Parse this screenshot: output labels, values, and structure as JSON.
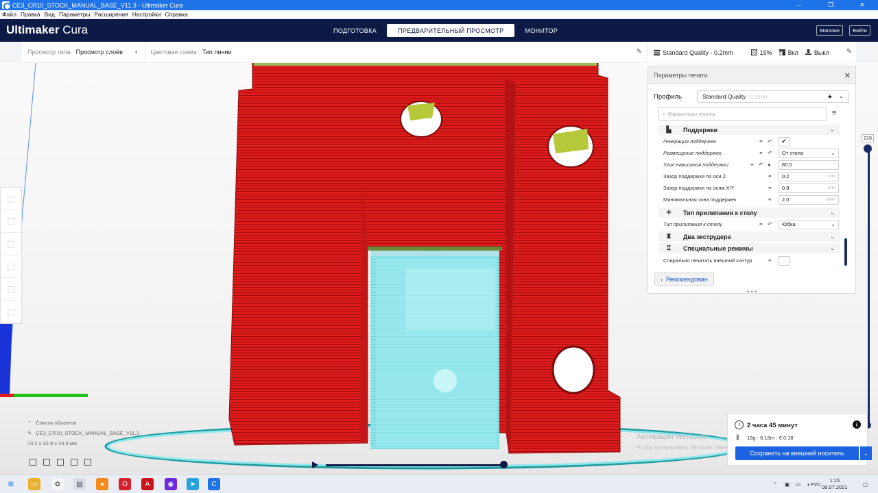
{
  "window": {
    "title": "CE3_CR10_STOCK_MANUAL_BASE_V11.3 - Ultimaker Cura",
    "minimize": "─",
    "restore": "❐",
    "close": "✕"
  },
  "menu": [
    "Файл",
    "Правка",
    "Вид",
    "Параметры",
    "Расширения",
    "Настройки",
    "Справка"
  ],
  "header": {
    "brand_bold": "Ultimaker",
    "brand_light": " Cura",
    "stages": [
      "ПОДГОТОВКА",
      "ПРЕДВАРИТЕЛЬНЫЙ ПРОСМОТР",
      "МОНИТОР"
    ],
    "active_stage": 1,
    "store_label": "Магазин",
    "login_label": "Войти"
  },
  "viewbar": {
    "view_type_label": "Просмотр типа",
    "view_type_value": "Просмотр слоёв",
    "color_scheme_label": "Цветовая схема",
    "color_scheme_value": "Тип линии"
  },
  "quality_bar": {
    "profile": "Standard Quality - 0.2mm",
    "infill": "15%",
    "support": "Вкл",
    "adhesion": "Выкл"
  },
  "print_settings": {
    "title": "Параметры печати",
    "profile_label": "Профиль",
    "profile_value": "Standard Quality",
    "profile_hint": "0.2mm",
    "search_placeholder": "Параметры поиска",
    "sections": {
      "support": "Поддержки",
      "adhesion": "Тип прилипания к столу",
      "dual": "Два экструдера",
      "special": "Специальные режимы"
    },
    "settings": {
      "support_enable": {
        "label": "Генерация поддержек",
        "checked": true
      },
      "support_placement": {
        "label": "Размещение поддержек",
        "value": "От стола"
      },
      "support_angle": {
        "label": "Угол нависания поддержки",
        "value": "80.0",
        "unit": "°"
      },
      "support_z_distance": {
        "label": "Зазор поддержки по оси Z",
        "value": "0.2",
        "unit": "mm"
      },
      "support_xy_distance": {
        "label": "Зазор поддержки по осям X/Y",
        "value": "0.8",
        "unit": "mm"
      },
      "support_min_area": {
        "label": "Минимальная зона поддержек",
        "value": "2.0",
        "unit": "mm²"
      },
      "adhesion_type": {
        "label": "Тип прилипания к столу",
        "value": "Юбка"
      },
      "spiralize": {
        "label": "Спирально печатать внешний контур",
        "checked": false
      }
    },
    "recommended_label": "Рекомендован"
  },
  "layer_slider": {
    "value": "219"
  },
  "object_list": {
    "toggle_label": "Список объектов",
    "object_name": "CE3_CR10_STOCK_MANUAL_BASE_V11.3",
    "dimensions": "73.2 x 32.9 x 43.9 мм"
  },
  "output": {
    "time": "2 часа 45 минут",
    "material": "18g · 6.18m · € 0.18",
    "save_label": "Сохранить на внешний носитель"
  },
  "watermark": {
    "line1": "Активация Windows",
    "line2": "Чтобы активировать Windows, перейдите в раздел \"Параметры\""
  },
  "taskbar": {
    "lang": "РУС",
    "time": "1:15",
    "date": "09.07.2021"
  },
  "colors": {
    "header_bg": "#0c1a45",
    "model_red": "#e01b1b",
    "support_cyan": "#8fe6ea",
    "accent_blue": "#1d62e0"
  }
}
